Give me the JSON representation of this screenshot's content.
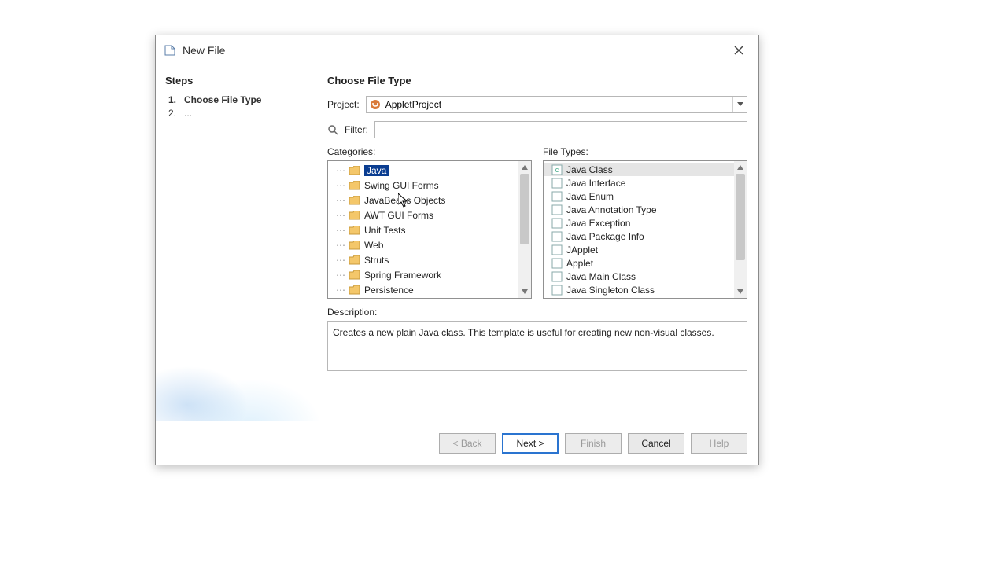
{
  "window": {
    "title": "New File"
  },
  "steps": {
    "title": "Steps",
    "items": [
      {
        "num": "1.",
        "label": "Choose File Type",
        "active": true
      },
      {
        "num": "2.",
        "label": "...",
        "active": false
      }
    ]
  },
  "main": {
    "title": "Choose File Type",
    "project_label": "Project:",
    "project_value": "AppletProject",
    "filter_label": "Filter:",
    "filter_value": "",
    "categories_label": "Categories:",
    "filetypes_label": "File Types:",
    "categories": [
      {
        "label": "Java",
        "selected": true
      },
      {
        "label": "Swing GUI Forms"
      },
      {
        "label": "JavaBeans Objects"
      },
      {
        "label": "AWT GUI Forms"
      },
      {
        "label": "Unit Tests"
      },
      {
        "label": "Web"
      },
      {
        "label": "Struts"
      },
      {
        "label": "Spring Framework"
      },
      {
        "label": "Persistence"
      }
    ],
    "filetypes": [
      {
        "label": "Java Class",
        "selected": true
      },
      {
        "label": "Java Interface"
      },
      {
        "label": "Java Enum"
      },
      {
        "label": "Java Annotation Type"
      },
      {
        "label": "Java Exception"
      },
      {
        "label": "Java Package Info"
      },
      {
        "label": "JApplet"
      },
      {
        "label": "Applet"
      },
      {
        "label": "Java Main Class"
      },
      {
        "label": "Java Singleton Class"
      }
    ],
    "description_label": "Description:",
    "description_text": "Creates a new plain Java class. This template is useful for creating new non-visual classes."
  },
  "buttons": {
    "back": "< Back",
    "next": "Next >",
    "finish": "Finish",
    "cancel": "Cancel",
    "help": "Help"
  }
}
